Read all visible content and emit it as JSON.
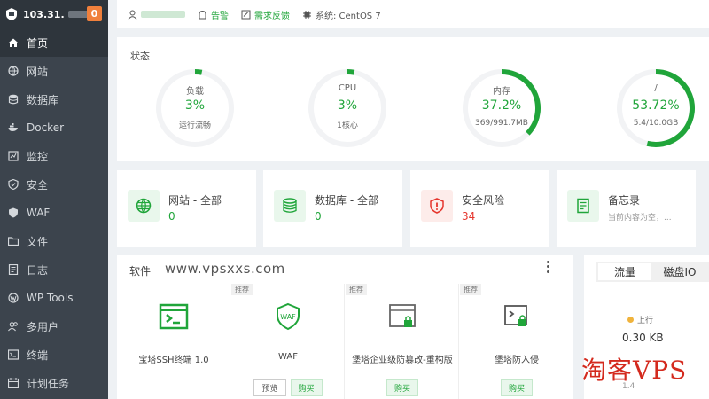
{
  "sidebar": {
    "ip": "103.31.",
    "badge": "0",
    "items": [
      {
        "label": "首页",
        "icon": "home-icon"
      },
      {
        "label": "网站",
        "icon": "globe-icon"
      },
      {
        "label": "数据库",
        "icon": "database-icon"
      },
      {
        "label": "Docker",
        "icon": "docker-icon"
      },
      {
        "label": "监控",
        "icon": "monitor-icon"
      },
      {
        "label": "安全",
        "icon": "shield-icon"
      },
      {
        "label": "WAF",
        "icon": "waf-shield-icon"
      },
      {
        "label": "文件",
        "icon": "folder-icon"
      },
      {
        "label": "日志",
        "icon": "log-icon"
      },
      {
        "label": "WP Tools",
        "icon": "wordpress-icon"
      },
      {
        "label": "多用户",
        "icon": "users-icon"
      },
      {
        "label": "终端",
        "icon": "terminal-icon"
      },
      {
        "label": "计划任务",
        "icon": "calendar-icon"
      }
    ]
  },
  "topbar": {
    "alert": "告警",
    "feedback": "需求反馈",
    "system": "系统: CentOS 7"
  },
  "status": {
    "title": "状态",
    "gauges": [
      {
        "label": "负载",
        "value": "3%",
        "sub": "运行流畅",
        "fraction": 0.03
      },
      {
        "label": "CPU",
        "value": "3%",
        "sub": "1核心",
        "fraction": 0.03
      },
      {
        "label": "内存",
        "value": "37.2%",
        "sub": "369/991.7MB",
        "fraction": 0.372
      },
      {
        "label": "/",
        "value": "53.72%",
        "sub": "5.4/10.0GB",
        "fraction": 0.5372
      }
    ]
  },
  "overview": [
    {
      "title": "网站 - 全部",
      "value": "0",
      "icon": "globe-icon"
    },
    {
      "title": "数据库 - 全部",
      "value": "0",
      "icon": "database-icon"
    },
    {
      "title": "安全风险",
      "value": "34",
      "icon": "shield-alert-icon"
    },
    {
      "title": "备忘录",
      "sub": "当前内容为空，...",
      "icon": "memo-icon"
    }
  ],
  "software": {
    "title": "软件",
    "watermark": "www.vpsxxs.com",
    "items": [
      {
        "name": "宝塔SSH终端 1.0",
        "tag": "",
        "icon": "ssh-terminal-icon"
      },
      {
        "name": "WAF",
        "tag": "推荐",
        "icon": "waf-icon",
        "preview": "预览",
        "buy": "购买"
      },
      {
        "name": "堡塔企业级防篡改-重构版",
        "tag": "推荐",
        "icon": "tamper-proof-icon",
        "buy": "购买"
      },
      {
        "name": "堡塔防入侵",
        "tag": "推荐",
        "icon": "intrusion-icon",
        "buy": "购买"
      }
    ]
  },
  "traffic": {
    "tab_traffic": "流量",
    "tab_disk": "磁盘IO",
    "up_label": "上行",
    "up_value": "0.30 KB",
    "down_fragment": "1.4"
  },
  "brand_watermark": "淘客VPS",
  "colors": {
    "accent": "#20a53a",
    "danger": "#e5352d",
    "sidebar": "#3c444d"
  }
}
